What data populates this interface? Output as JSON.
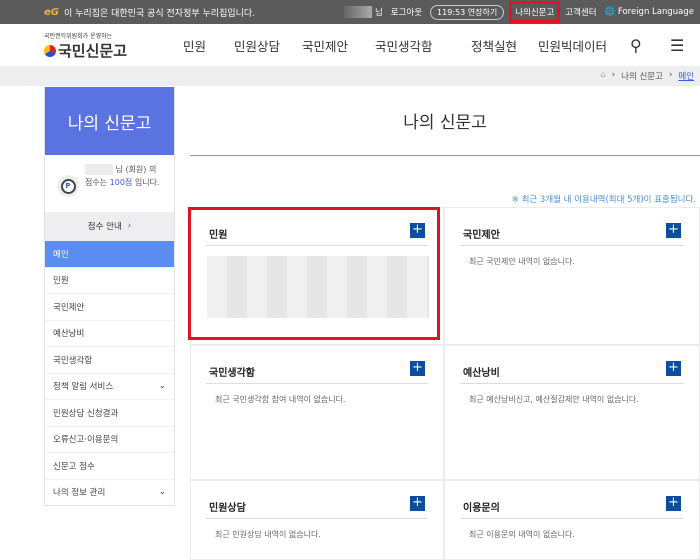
{
  "topbar": {
    "gov_logo": "eG",
    "gov_notice": "이 누리집은 대한민국 공식 전자정부 누리집입니다.",
    "user_suffix": "님",
    "logout": "로그아웃",
    "timer": "119:53 연장하기",
    "my_sinmungo": "나의신문고",
    "customer_center": "고객센터",
    "foreign_language": "Foreign Language"
  },
  "header": {
    "logo_sub": "국민권익위원회가 운영하는",
    "logo_main": "국민신문고",
    "nav": [
      "민원",
      "민원상담",
      "국민제안",
      "국민생각함",
      "정책실현",
      "민원빅데이터"
    ],
    "search_icon": "search-icon",
    "menu_icon": "hamburger-icon"
  },
  "breadcrumb": {
    "items": [
      "나의 신문고",
      "메인"
    ]
  },
  "sidebar": {
    "title": "나의 신문고",
    "profile": {
      "suffix": "님 (회원) 의",
      "score_prefix": "점수는",
      "score": "100점",
      "score_suffix": "입니다."
    },
    "score_guide": "점수 안내",
    "menu": [
      {
        "label": "메인",
        "active": true
      },
      {
        "label": "민원"
      },
      {
        "label": "국민제안"
      },
      {
        "label": "예산낭비"
      },
      {
        "label": "국민생각함"
      },
      {
        "label": "정책 알림 서비스",
        "expand": true
      },
      {
        "label": "민원상담 신청결과"
      },
      {
        "label": "오류신고·이용문의"
      },
      {
        "label": "신문고 점수"
      },
      {
        "label": "나의 정보 관리",
        "expand": true
      }
    ]
  },
  "main": {
    "title": "나의 신문고",
    "notice": "※ 최근 3개월 내 이용내역(최대 5개)이 표출됩니다.",
    "cards": [
      {
        "title": "민원",
        "message": ""
      },
      {
        "title": "국민제안",
        "message": "최근 국민제안 내역이 없습니다."
      },
      {
        "title": "국민생각함",
        "message": "최근 국민생각함 참여 내역이 없습니다."
      },
      {
        "title": "예산낭비",
        "message": "최근 예산낭비신고, 예산절감제안 내역이 없습니다."
      },
      {
        "title": "민원상담",
        "message": "최근 민원상담 내역이 없습니다."
      },
      {
        "title": "이용문의",
        "message": "최근 이용문의 내역이 없습니다."
      }
    ]
  },
  "colors": {
    "accent": "#5b73e0",
    "active_menu": "#5b8cf0",
    "plus_button": "#0b4f9c",
    "highlight": "#e0141e"
  }
}
